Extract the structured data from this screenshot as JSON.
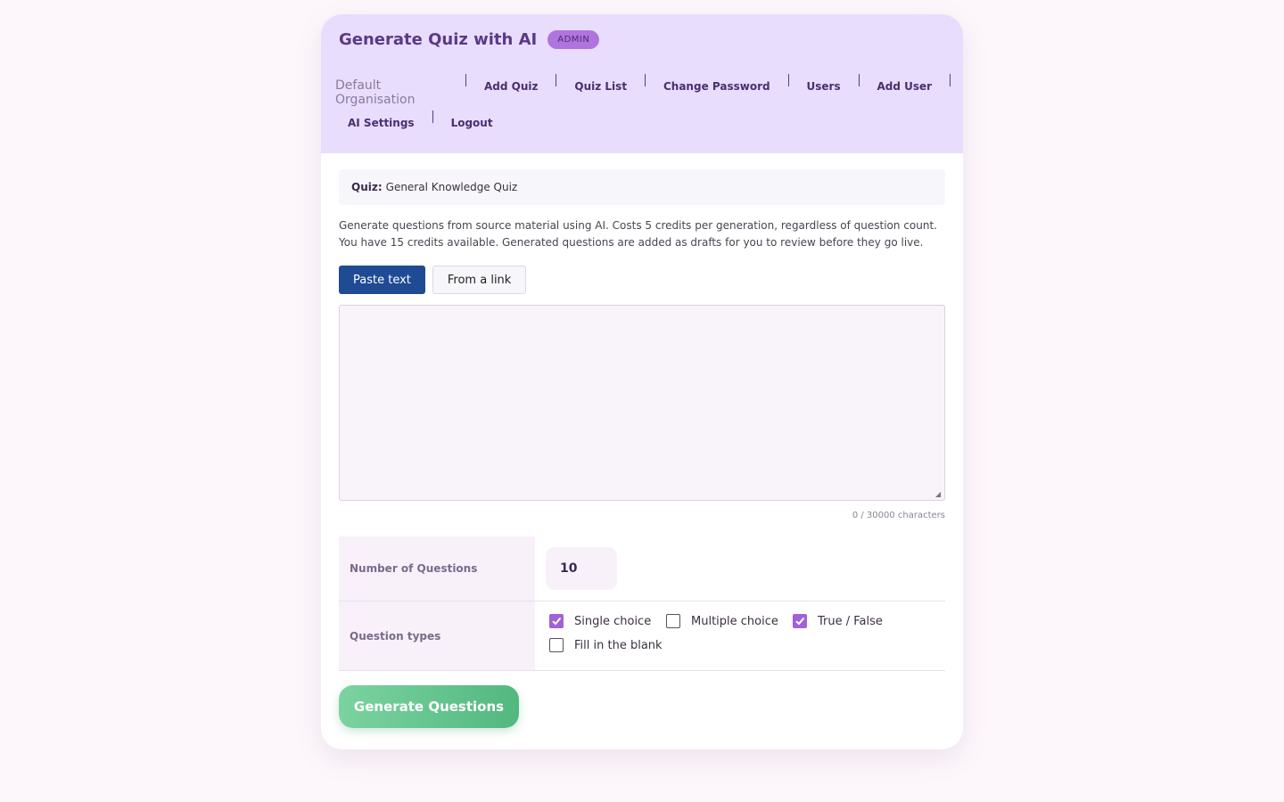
{
  "header": {
    "title": "Generate Quiz with AI",
    "badge": "ADMIN",
    "org_name": "Default Organisation",
    "nav": [
      "Add Quiz",
      "Quiz List",
      "Change Password",
      "Users",
      "Add User",
      "AI Settings",
      "Logout"
    ]
  },
  "quiz": {
    "label": "Quiz:",
    "name": "General Knowledge Quiz"
  },
  "description": {
    "line1": "Generate questions from source material using AI. Costs 5 credits per generation, regardless of question count.",
    "line2": "You have 15 credits available. Generated questions are added as drafts for you to review before they go live."
  },
  "source_tabs": {
    "paste": "Paste text",
    "link": "From a link",
    "active": "paste"
  },
  "textarea": {
    "value": "",
    "char_count": "0 / 30000 characters"
  },
  "form": {
    "num_label": "Number of Questions",
    "num_value": "10",
    "types_label": "Question types",
    "types": [
      {
        "label": "Single choice",
        "checked": true
      },
      {
        "label": "Multiple choice",
        "checked": false
      },
      {
        "label": "True / False",
        "checked": true
      },
      {
        "label": "Fill in the blank",
        "checked": false
      }
    ]
  },
  "generate_button": "Generate Questions",
  "colors": {
    "header_bg": "#e9ddfd",
    "accent_purple": "#a261d6",
    "primary_blue": "#1f4a94",
    "generate_green": "#5cc18a"
  }
}
